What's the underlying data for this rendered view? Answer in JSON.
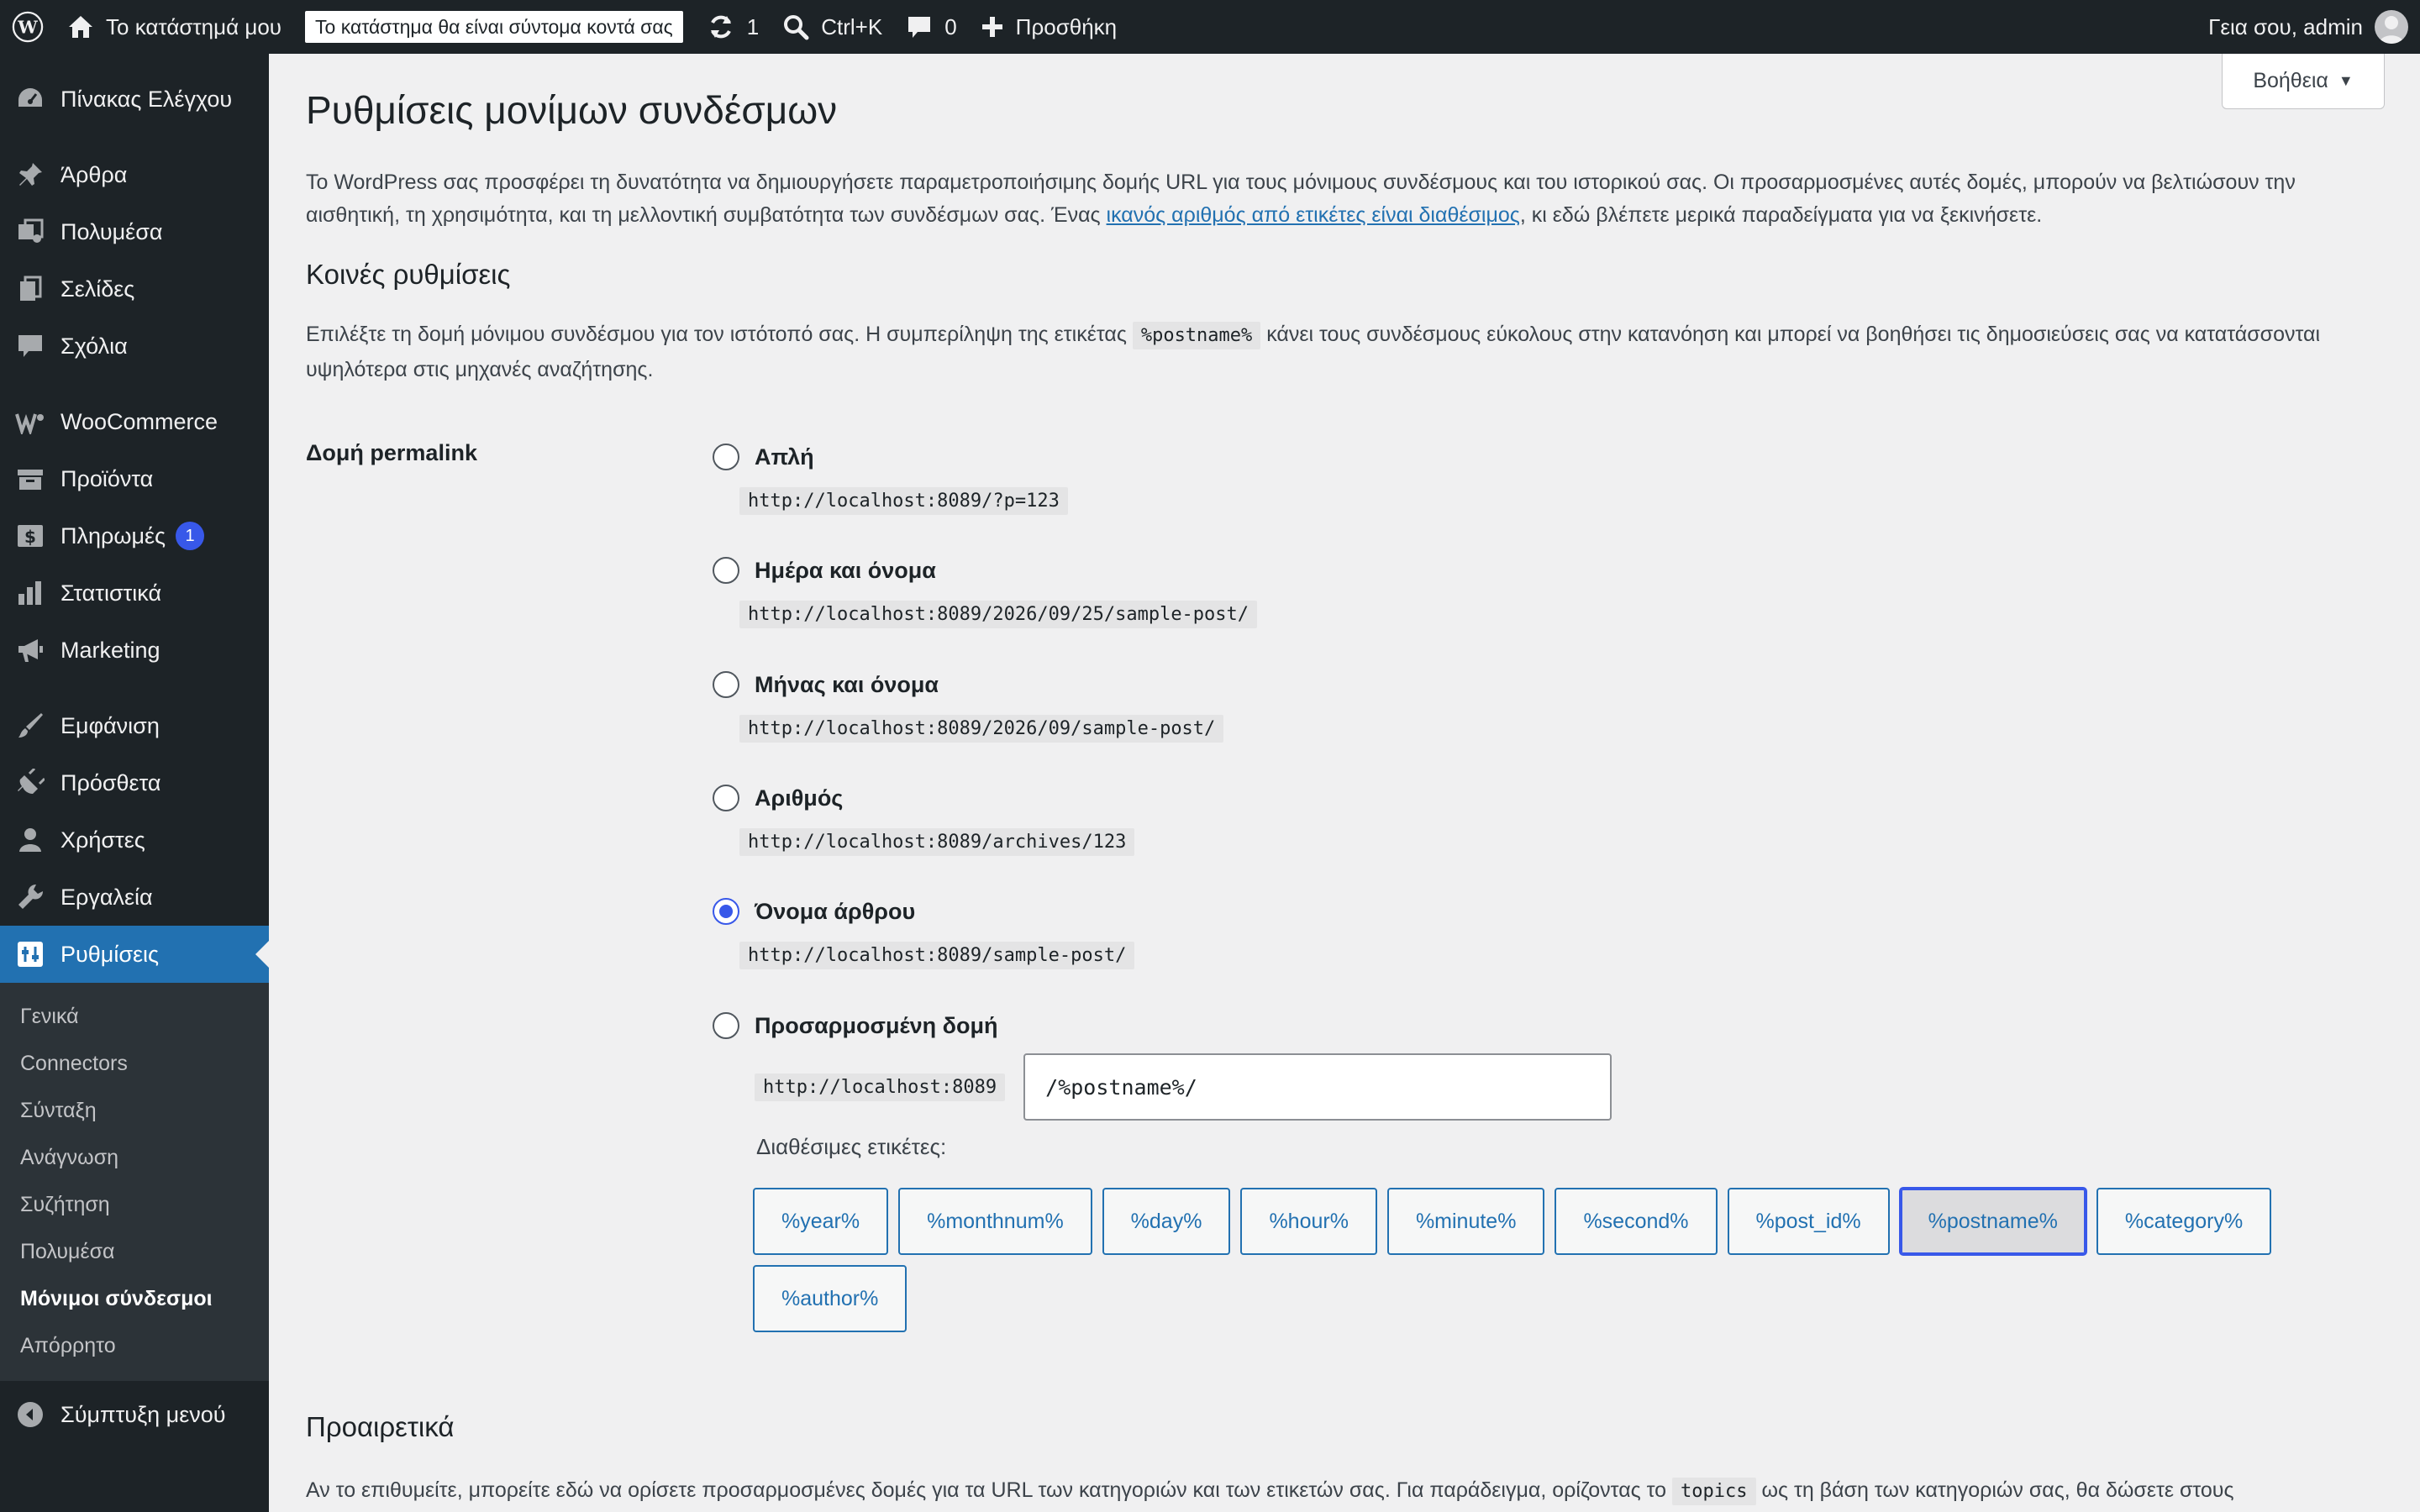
{
  "adminbar": {
    "site_name": "Το κατάστημά μου",
    "store_notice": "Το κατάστημα θα είναι σύντομα κοντά σας",
    "updates_count": "1",
    "shortcut": "Ctrl+K",
    "comments_count": "0",
    "new_label": "Προσθήκη",
    "greeting": "Γεια σου, admin"
  },
  "sidebar": {
    "items": [
      {
        "label": "Πίνακας Ελέγχου",
        "icon": "dashboard-icon"
      },
      {
        "label": "Άρθρα",
        "icon": "pin-icon"
      },
      {
        "label": "Πολυμέσα",
        "icon": "media-icon"
      },
      {
        "label": "Σελίδες",
        "icon": "pages-icon"
      },
      {
        "label": "Σχόλια",
        "icon": "comments-icon"
      },
      {
        "label": "WooCommerce",
        "icon": "woo-icon"
      },
      {
        "label": "Προϊόντα",
        "icon": "products-icon"
      },
      {
        "label": "Πληρωμές",
        "icon": "payments-icon",
        "badge": "1"
      },
      {
        "label": "Στατιστικά",
        "icon": "stats-icon"
      },
      {
        "label": "Marketing",
        "icon": "megaphone-icon"
      },
      {
        "label": "Εμφάνιση",
        "icon": "brush-icon"
      },
      {
        "label": "Πρόσθετα",
        "icon": "plugin-icon"
      },
      {
        "label": "Χρήστες",
        "icon": "users-icon"
      },
      {
        "label": "Εργαλεία",
        "icon": "wrench-icon"
      },
      {
        "label": "Ρυθμίσεις",
        "icon": "settings-icon"
      }
    ],
    "submenu": [
      "Γενικά",
      "Connectors",
      "Σύνταξη",
      "Ανάγνωση",
      "Συζήτηση",
      "Πολυμέσα",
      "Μόνιμοι σύνδεσμοι",
      "Απόρρητο"
    ],
    "collapse_label": "Σύμπτυξη μενού"
  },
  "help_label": "Βοήθεια",
  "page": {
    "title": "Ρυθμίσεις μονίμων συνδέσμων",
    "intro_before": "Το WordPress σας προσφέρει τη δυνατότητα να δημιουργήσετε παραμετροποιήσιμης δομής URL για τους μόνιμους συνδέσμους και του ιστορικού σας. Οι προσαρμοσμένες αυτές δομές, μπορούν να βελτιώσουν την αισθητική, τη χρησιμότητα, και τη μελλοντική συμβατότητα των συνδέσμων σας. Ένας ",
    "intro_link": "ικανός αριθμός από ετικέτες είναι διαθέσιμος",
    "intro_after": ", κι εδώ βλέπετε μερικά παραδείγματα για να ξεκινήσετε.",
    "common_heading": "Κοινές ρυθμίσεις",
    "common_desc_before": "Επιλέξτε τη δομή μόνιμου συνδέσμου για τον ιστότοπό σας. Η συμπερίληψη της ετικέτας ",
    "common_desc_code": "%postname%",
    "common_desc_after": " κάνει τους συνδέσμους εύκολους στην κατανόηση και μπορεί να βοηθήσει τις δημοσιεύσεις σας να κατατάσσονται υψηλότερα στις μηχανές αναζήτησης.",
    "structure_label": "Δομή permalink",
    "options": [
      {
        "label": "Απλή",
        "example": "http://localhost:8089/?p=123",
        "checked": false
      },
      {
        "label": "Ημέρα και όνομα",
        "example": "http://localhost:8089/2026/09/25/sample-post/",
        "checked": false
      },
      {
        "label": "Μήνας και όνομα",
        "example": "http://localhost:8089/2026/09/sample-post/",
        "checked": false
      },
      {
        "label": "Αριθμός",
        "example": "http://localhost:8089/archives/123",
        "checked": false
      },
      {
        "label": "Όνομα άρθρου",
        "example": "http://localhost:8089/sample-post/",
        "checked": true
      },
      {
        "label": "Προσαρμοσμένη δομή",
        "checked": false
      }
    ],
    "custom_base": "http://localhost:8089",
    "custom_value": "/%postname%/",
    "available_tags_label": "Διαθέσιμες ετικέτες:",
    "tags": [
      "%year%",
      "%monthnum%",
      "%day%",
      "%hour%",
      "%minute%",
      "%second%",
      "%post_id%",
      "%postname%",
      "%category%",
      "%author%"
    ],
    "active_tag": "%postname%",
    "optional_heading": "Προαιρετικά",
    "optional_desc_before": "Αν το επιθυμείτε, μπορείτε εδώ να ορίσετε προσαρμοσμένες δομές για τα URL των κατηγοριών και των ετικετών σας. Για παράδειγμα, ορίζοντας το ",
    "optional_desc_code": "topics",
    "optional_desc_after": " ως τη βάση των κατηγοριών σας, θα δώσετε στους"
  },
  "colors": {
    "accent": "#2271b1",
    "admin_dark": "#1d2327",
    "radio_checked": "#3858e9"
  }
}
